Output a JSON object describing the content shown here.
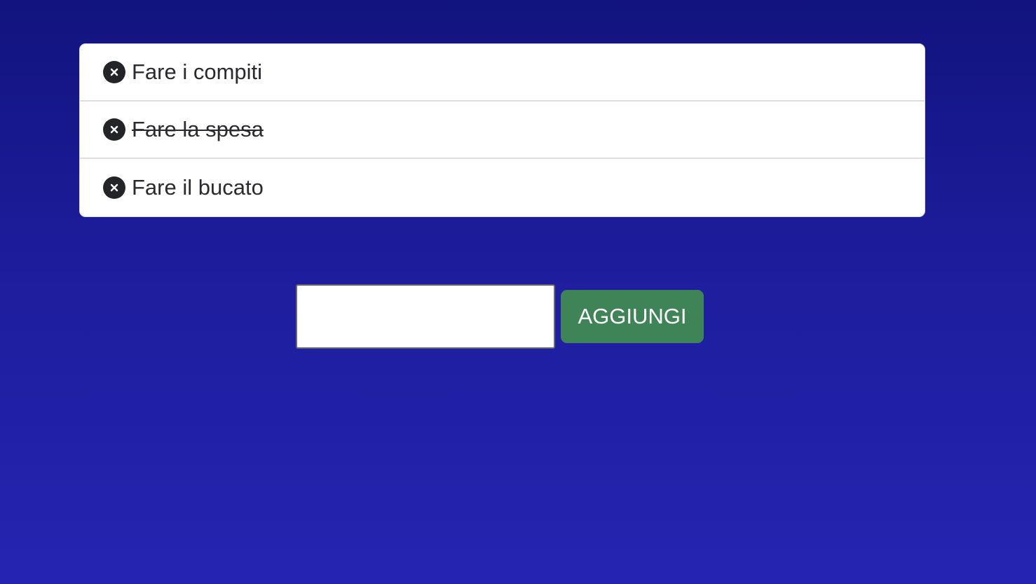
{
  "todos": [
    {
      "text": "Fare i compiti",
      "done": false
    },
    {
      "text": "Fare la spesa",
      "done": true
    },
    {
      "text": "Fare il bucato",
      "done": false
    }
  ],
  "form": {
    "input_value": "",
    "add_label": "AGGIUNGI"
  },
  "icons": {
    "remove": "close-circle-icon"
  },
  "colors": {
    "background_top": "#12137e",
    "background_bottom": "#2424b2",
    "add_button": "#3f8456",
    "icon": "#222428"
  }
}
